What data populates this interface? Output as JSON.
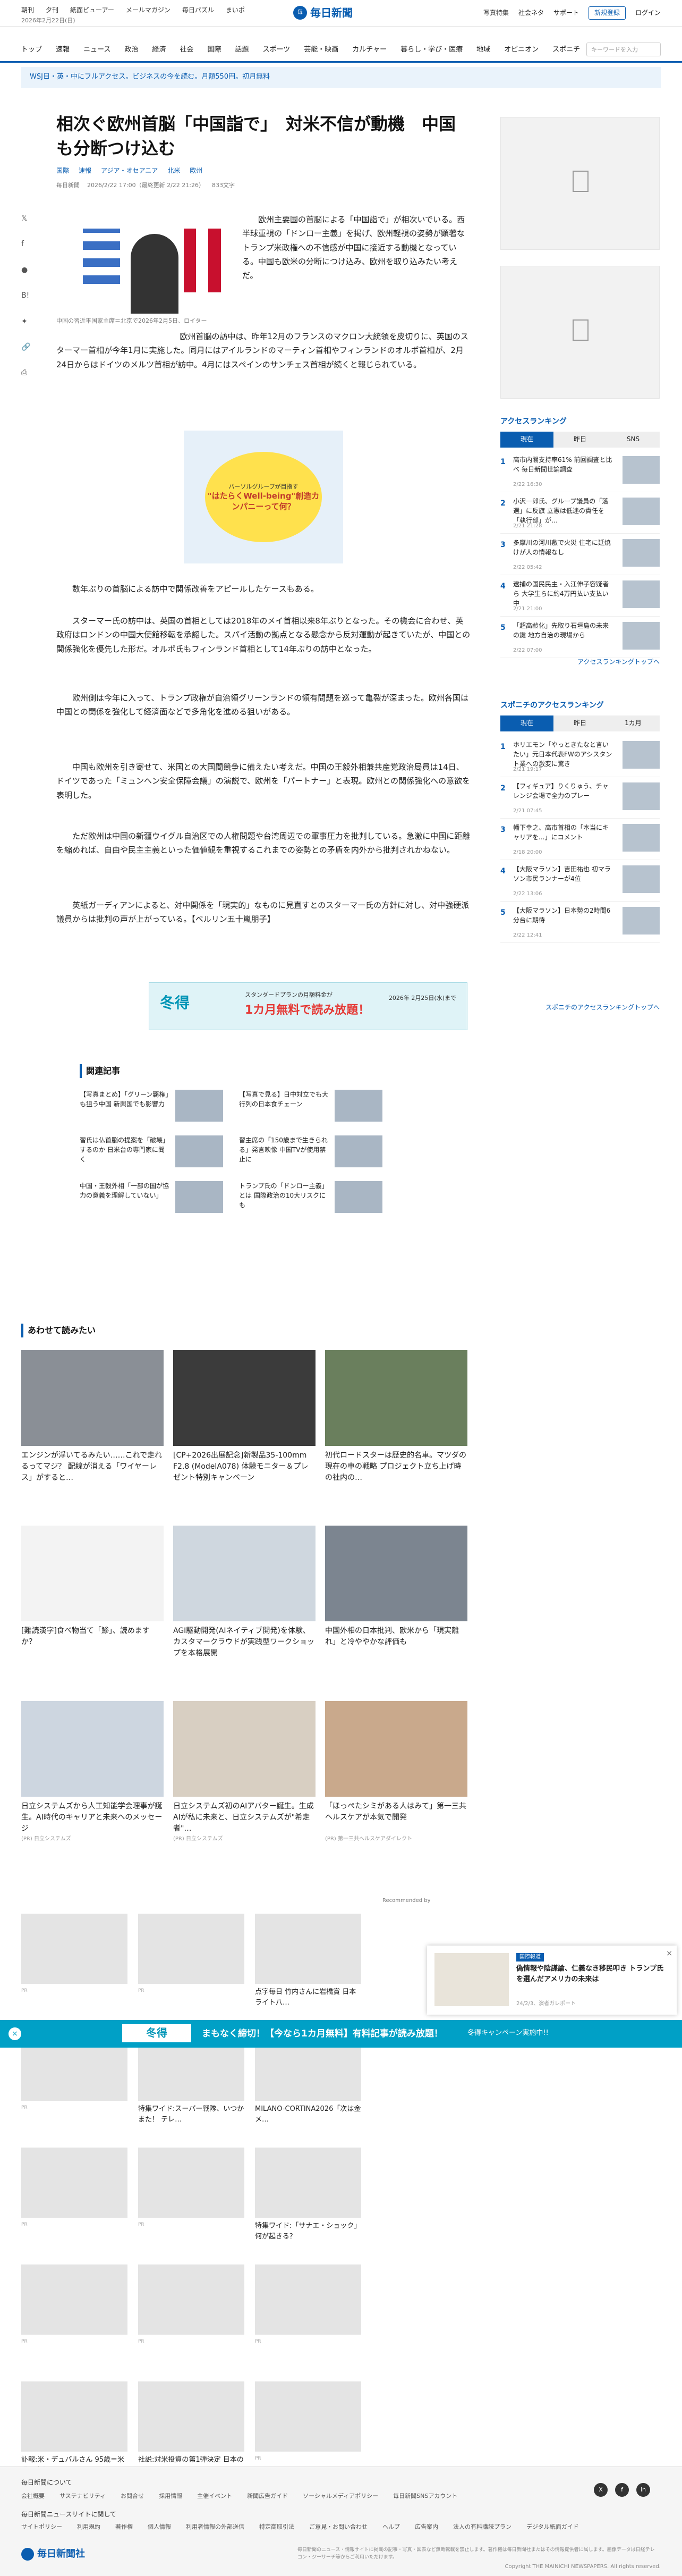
{
  "header": {
    "links": [
      "朝刊",
      "夕刊",
      "紙面ビューアー",
      "メールマガジン",
      "毎日パズル",
      "まいポ"
    ],
    "date": "2026年2月22日(日)",
    "logo_text": "毎日新聞",
    "right": [
      "写真特集",
      "社会ネタ",
      "サポート"
    ],
    "register": "新規登録",
    "login": "ログイン"
  },
  "nav": {
    "items": [
      "トップ",
      "速報",
      "ニュース",
      "政治",
      "経済",
      "社会",
      "国際",
      "話題",
      "スポーツ",
      "芸能・映画",
      "カルチャー",
      "暮らし・学び・医療",
      "地域",
      "オピニオン",
      "スポニチ"
    ],
    "search_placeholder": "キーワードを入力"
  },
  "banner": "WSJ日・英・中にフルアクセス。ビジネスの今を読む。月額550円。初月無料",
  "article": {
    "title": "相次ぐ欧州首脳「中国詣で」　対米不信が動機　中国も分断つけ込む",
    "tags": [
      "国際",
      "速報",
      "アジア・オセアニア",
      "北米",
      "欧州"
    ],
    "source": "毎日新聞",
    "date": "2026/2/22 17:00（最終更新 2/22 21:26）",
    "chars": "833文字",
    "caption": "中国の習近平国家主席＝北京で2026年2月5日、ロイター",
    "p1": "欧州主要国の首脳による「中国詣で」が相次いでいる。西半球重視の「ドンロー主義」を掲げ、欧州軽視の姿勢が顕著なトランプ米政権への不信感が中国に接近する動機となっている。中国も欧米の分断につけ込み、欧州を取り込みたい考えだ。",
    "p2": "欧州首脳の訪中は、昨年12月のフランスのマクロン大統領を皮切りに、英国のスターマー首相が今年1月に実施した。同月にはアイルランドのマーティン首相やフィンランドのオルポ首相が、2月24日からはドイツのメルツ首相が訪中。4月にはスペインのサンチェス首相が続くと報じられている。",
    "ad_line1": "パーソルグループが目指す",
    "ad_line2": "\"はたらくWell-being\"創造カンパニーって何？",
    "p3": "数年ぶりの首脳による訪中で関係改善をアピールしたケースもある。",
    "p4": "スターマー氏の訪中は、英国の首相としては2018年のメイ首相以来8年ぶりとなった。その機会に合わせ、英政府はロンドンの中国大使館移転を承認した。スパイ活動の拠点となる懸念から反対運動が起きていたが、中国との関係強化を優先した形だ。オルポ氏もフィンランド首相として14年ぶりの訪中となった。",
    "p5": "欧州側は今年に入って、トランプ政権が自治領グリーンランドの領有問題を巡って亀裂が深まった。欧州各国は中国との関係を強化して経済面などで多角化を進める狙いがある。",
    "p6": "中国も欧州を引き寄せて、米国との大国間競争に備えたい考えだ。中国の王毅外相兼共産党政治局員は14日、ドイツであった「ミュンヘン安全保障会議」の演説で、欧州を「パートナー」と表現。欧州との関係強化への意欲を表明した。",
    "p7": "ただ欧州は中国の新疆ウイグル自治区での人権問題や台湾周辺での軍事圧力を批判している。急激に中国に距離を縮めれば、自由や民主主義といった価値観を重視するこれまでの姿勢との矛盾を内外から批判されかねない。",
    "p8": "英紙ガーディアンによると、対中関係を「現実的」なものに見直すとのスターマー氏の方針に対し、対中強硬派議員からは批判の声が上がっている。【ベルリン五十嵐朋子】",
    "promo_left": "冬得",
    "promo_mid1": "スタンダードプランの月額料金が",
    "promo_mid2": "1カ月無料で読み放題！",
    "promo_right": "2026年 2月25日(水)まで"
  },
  "share_icons": [
    "x-icon",
    "facebook-icon",
    "line-icon",
    "hatena-icon",
    "bluesky-icon",
    "link-icon",
    "print-icon"
  ],
  "ranking": {
    "title": "アクセスランキング",
    "tabs": [
      "現在",
      "昨日",
      "SNS"
    ],
    "items": [
      {
        "t": "高市内閣支持率61% 前回調査と比べ 毎日新聞世論調査",
        "d": "2/22 16:30"
      },
      {
        "t": "小沢一郎氏、グループ議員の「落選」に反旗 立憲は低迷の責任を「執行部」が…",
        "d": "2/21 21:28"
      },
      {
        "t": "多摩川の河川敷で火災 住宅に延焼 けが人の情報なし",
        "d": "2/22 05:42"
      },
      {
        "t": "逮捕の国民民主・入江伸子容疑者ら 大学生らに約4万円払い支払い中",
        "d": "2/21 21:00"
      },
      {
        "t": "「超高齢化」先取り石垣島の未来の鍵 地方自治の現場から",
        "d": "2/22 07:00"
      }
    ],
    "more": "アクセスランキングトップへ"
  },
  "sponichi": {
    "title": "スポニチのアクセスランキング",
    "tabs": [
      "現在",
      "昨日",
      "1カ月"
    ],
    "items": [
      {
        "t": "ホリエモン「やっときたなと言いたい」元日本代表FWのアシスタント業への激変に驚き",
        "d": "2/21 19:17"
      },
      {
        "t": "【フィギュア】りくりゅう、チャレンジ会場で全力のプレー",
        "d": "2/21 07:45"
      },
      {
        "t": "幡下幸之、高市首相の「本当にキャリアを...」にコメント",
        "d": "2/18 20:00"
      },
      {
        "t": "【大阪マラソン】吉田祐也 初マラソン市民ランナーが4位",
        "d": "2/22 13:06"
      },
      {
        "t": "【大阪マラソン】日本勢の2時間6分台に期待",
        "d": "2/22 12:41"
      }
    ],
    "more": "スポニチのアクセスランキングトップへ"
  },
  "related": {
    "title": "関連記事",
    "items": [
      "【写真まとめ】「グリーン覇権」も狙う中国 新興国でも影響力",
      "【写真で見る】日中対立でも大行列の日本食チェーン",
      "習氏は仏首脳の提案を「破壊」するのか 日米台の専門家に聞く",
      "習主席の「150歳まで生きられる」発言映像 中国TVが使用禁止に",
      "中国・王毅外相「一部の国が協力の意義を理解していない」",
      "トランプ氏の「ドンロー主義」とは 国際政治の10大リスクにも"
    ]
  },
  "recommended": {
    "title": "あわせて読みたい",
    "cards": [
      {
        "t": "エンジンが浮いてるみたい……これで走れるってマジ？ 配線が消える「ワイヤーレス」がすると…",
        "s": ""
      },
      {
        "t": "[CP+2026出展記念]新製品35-100mm F2.8 (ModelA078) 体験モニター＆プレゼント特別キャンペーン",
        "s": ""
      },
      {
        "t": "初代ロードスターは歴史的名車。マツダの現在の車の戦略 プロジェクト立ち上げ時の社内の…",
        "s": ""
      },
      {
        "t": "[難読漢字]食べ物当て「鯵」、読めますか？",
        "s": ""
      },
      {
        "t": "AGI駆動開発(AIネイティブ開発)を体験、カスタマークラウドが実践型ワークショップを本格展開",
        "s": ""
      },
      {
        "t": "中国外相の日本批判、欧米から「現実離れ」と冷ややかな評価も",
        "s": ""
      },
      {
        "t": "日立システムズから人工知能学会理事が誕生。AI時代のキャリアと未来へのメッセージ",
        "s": "(PR) 日立システムズ"
      },
      {
        "t": "日立システムズ初のAIアバター誕生。生成AIが私に未来と、日立システムズが\"希走者\"…",
        "s": "(PR) 日立システムズ"
      },
      {
        "t": "「ほっぺたシミがある人はみて」第一三共ヘルスケアが本気で開発",
        "s": "(PR) 第一三共ヘルスケアダイレクト"
      }
    ],
    "label": "Recommended by"
  },
  "grid": [
    {
      "t": "",
      "s": "PR"
    },
    {
      "t": "",
      "s": "PR"
    },
    {
      "t": "点字毎日 竹内さんに岩橋賞 日本ライト八…",
      "s": ""
    },
    {
      "t": "",
      "s": "PR"
    },
    {
      "t": "特集ワイド:スーパー戦隊、いつかまた！ テレ…",
      "s": ""
    },
    {
      "t": "MILANO-CORTINA2026「次は金メ…",
      "s": ""
    },
    {
      "t": "",
      "s": "PR"
    },
    {
      "t": "",
      "s": "PR"
    },
    {
      "t": "特集ワイド:「サナエ・ショック」何が起きる？",
      "s": ""
    },
    {
      "t": "",
      "s": "PR"
    },
    {
      "t": "",
      "s": "PR"
    },
    {
      "t": "",
      "s": "PR"
    },
    {
      "t": "訃報:米・デュバルさん 95歳＝米俳優｜毎日…",
      "s": ""
    },
    {
      "t": "社説:対米投資の第1弾決定 日本の国益に…",
      "s": ""
    },
    {
      "t": "",
      "s": "PR"
    }
  ],
  "popup": {
    "tag": "国際報道",
    "title": "偽情報や陰謀論、仁義なき移民叩き トランプ氏を選んだアメリカの未来は",
    "sub": "24/2/3、演者ガレポート"
  },
  "floatbar": {
    "close": "×",
    "badge": "冬得",
    "main": "まもなく締切！【今なら1カ月無料】有料記事が読み放題！",
    "right": "冬得キャンペーン実施中!!"
  },
  "footer": {
    "h1": "毎日新聞について",
    "row1": [
      "会社概要",
      "サステナビリティ",
      "お問合せ",
      "採用情報",
      "主催イベント",
      "新聞広告ガイド",
      "ソーシャルメディアポリシー",
      "毎日新聞SNSアカウント"
    ],
    "h2": "毎日新聞ニュースサイトに関して",
    "row2": [
      "サイトポリシー",
      "利用規約",
      "著作権",
      "個人情報",
      "利用者情報の外部送信",
      "特定商取引法",
      "ご意見・お問い合わせ",
      "ヘルプ",
      "広告案内",
      "法人の有料購読プラン",
      "デジタル紙面ガイド"
    ],
    "sns": [
      "X",
      "f",
      "in"
    ],
    "logo": "毎日新聞社",
    "note": "毎日新聞のニュース・情報サイトに掲載の記事・写真・図表など無断転載を禁止します。著作権は毎日新聞社またはその情報提供者に属します。画像データは日経テレコン・ジーサーチ等からご利用いただけます。",
    "copyright": "Copyright THE MAINICHI NEWSPAPERS. All rights reserved."
  }
}
